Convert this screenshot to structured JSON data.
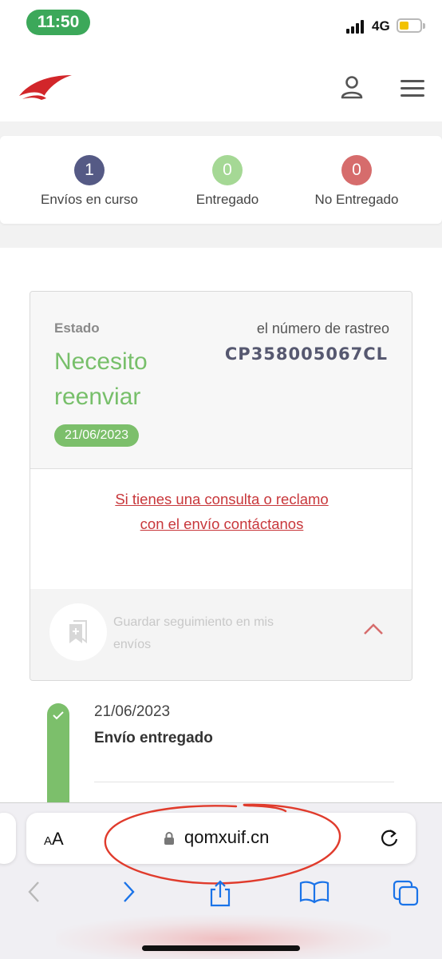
{
  "status_bar": {
    "time": "11:50",
    "network": "4G"
  },
  "header": {
    "logo_icon": "red-wing-logo",
    "user_icon": "user-icon",
    "menu_icon": "hamburger-menu-icon"
  },
  "summary": {
    "stats": [
      {
        "count": "1",
        "label": "Envíos en curso",
        "color": "#555a85"
      },
      {
        "count": "0",
        "label": "Entregado",
        "color": "#a5d895"
      },
      {
        "count": "0",
        "label": "No Entregado",
        "color": "#d66c6c"
      }
    ]
  },
  "shipment": {
    "estado_label": "Estado",
    "estado_value": "Necesito reenviar",
    "date": "21/06/2023",
    "tracking_label": "el número de rastreo",
    "tracking_number": "CP358005067CL",
    "contact_link": "Si tienes una consulta o reclamo con el envío contáctanos",
    "save_label": "Guardar seguimiento en mis envíos"
  },
  "timeline": {
    "events": [
      {
        "date": "21/06/2023",
        "event": "Envío entregado"
      }
    ]
  },
  "browser": {
    "text_size_button": "AA",
    "url": "qomxuif.cn"
  },
  "colors": {
    "accent_red": "#c8373b",
    "status_green": "#77bf6a",
    "ios_blue": "#1a73e8"
  }
}
